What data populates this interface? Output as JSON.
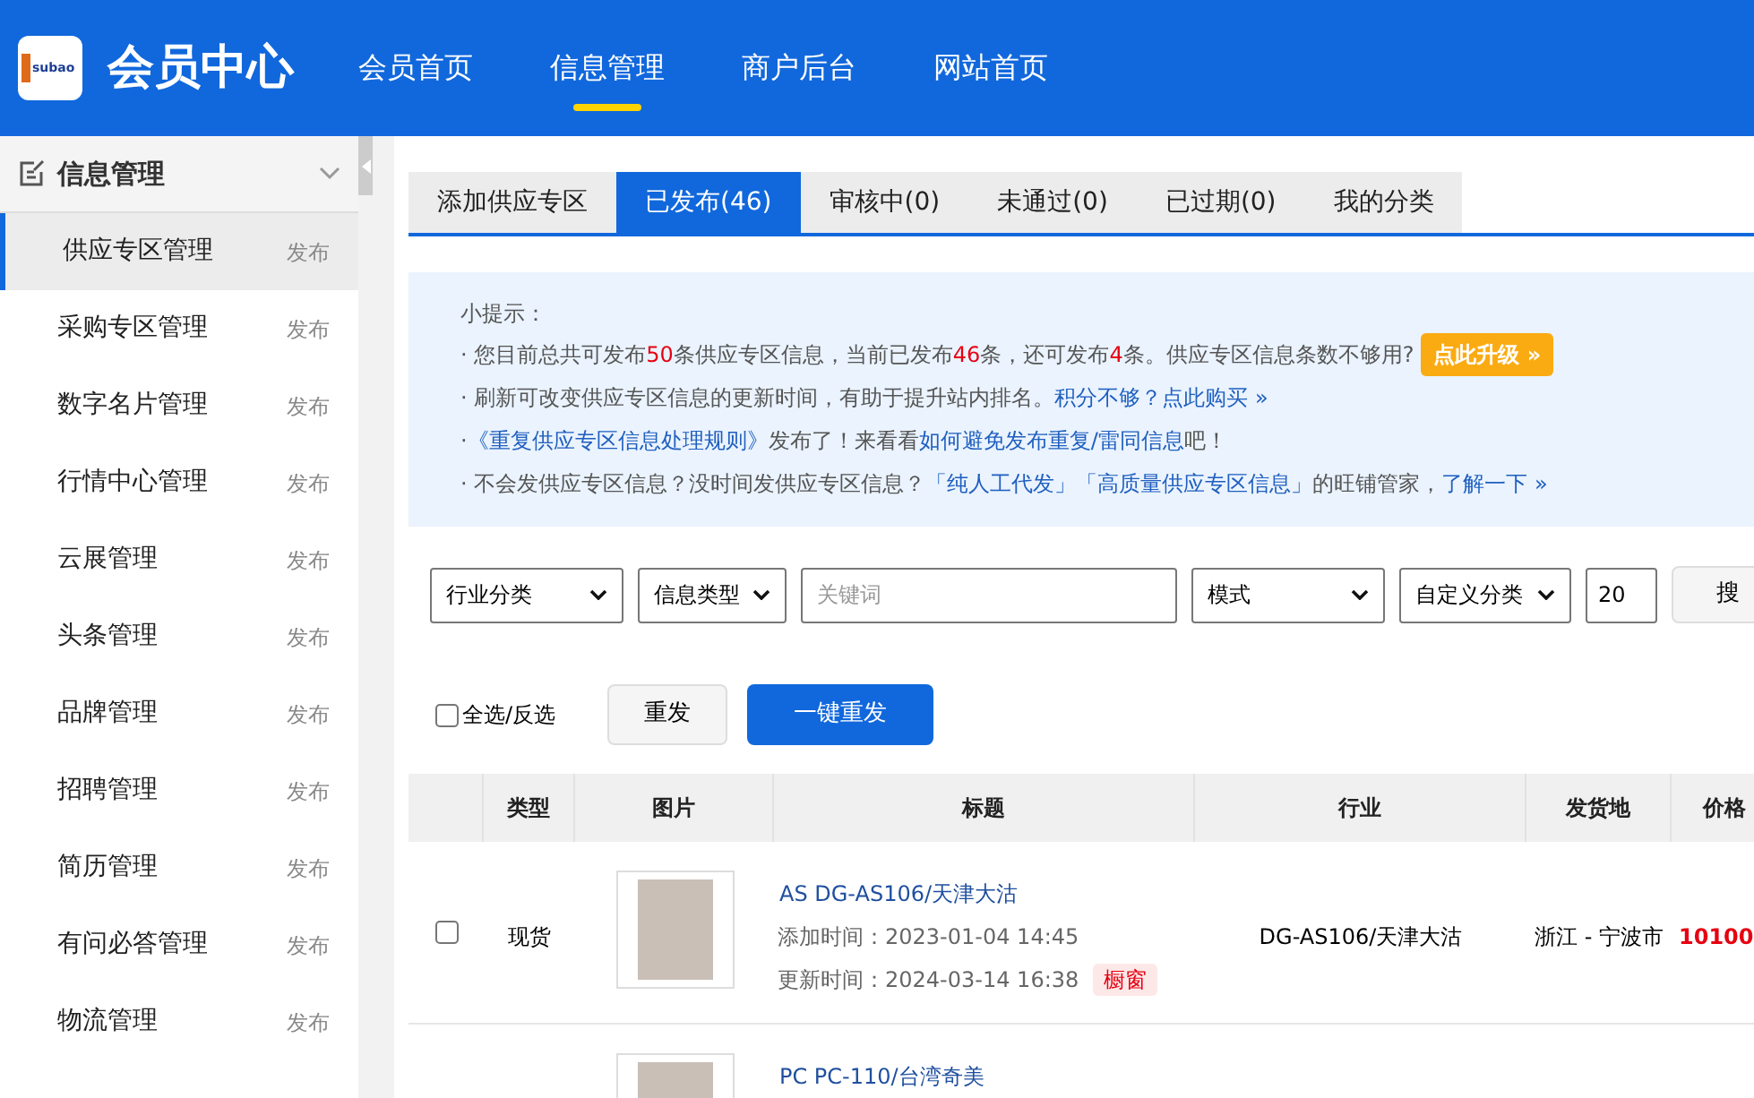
{
  "header": {
    "logo_text": "subao",
    "title": "会员中心",
    "nav": [
      {
        "label": "会员首页",
        "selected": false
      },
      {
        "label": "信息管理",
        "selected": true
      },
      {
        "label": "商户后台",
        "selected": false
      },
      {
        "label": "网站首页",
        "selected": false
      }
    ]
  },
  "sidebar": {
    "title": "信息管理",
    "expanded": true,
    "items": [
      {
        "label": "供应专区管理",
        "action": "发布",
        "selected": true
      },
      {
        "label": "采购专区管理",
        "action": "发布",
        "selected": false
      },
      {
        "label": "数字名片管理",
        "action": "发布",
        "selected": false
      },
      {
        "label": "行情中心管理",
        "action": "发布",
        "selected": false
      },
      {
        "label": "云展管理",
        "action": "发布",
        "selected": false
      },
      {
        "label": "头条管理",
        "action": "发布",
        "selected": false
      },
      {
        "label": "品牌管理",
        "action": "发布",
        "selected": false
      },
      {
        "label": "招聘管理",
        "action": "发布",
        "selected": false
      },
      {
        "label": "简历管理",
        "action": "发布",
        "selected": false
      },
      {
        "label": "有问必答管理",
        "action": "发布",
        "selected": false
      },
      {
        "label": "物流管理",
        "action": "发布",
        "selected": false
      }
    ]
  },
  "tabs": [
    {
      "label": "添加供应专区",
      "selected": false
    },
    {
      "label": "已发布(46)",
      "selected": true
    },
    {
      "label": "审核中(0)",
      "selected": false
    },
    {
      "label": "未通过(0)",
      "selected": false
    },
    {
      "label": "已过期(0)",
      "selected": false
    },
    {
      "label": "我的分类",
      "selected": false
    }
  ],
  "tips": {
    "title": "小提示：",
    "lines": [
      [
        {
          "kind": "text",
          "text": "· 您目前总共可发布"
        },
        {
          "kind": "red",
          "text": "50"
        },
        {
          "kind": "text",
          "text": "条供应专区信息，当前已发布 "
        },
        {
          "kind": "red",
          "text": "46"
        },
        {
          "kind": "text",
          "text": " 条，还可发布"
        },
        {
          "kind": "red",
          "text": "4"
        },
        {
          "kind": "text",
          "text": "条。供应专区信息条数不够用?"
        },
        {
          "kind": "button",
          "text": "点此升级 »"
        }
      ],
      [
        {
          "kind": "text",
          "text": "· 刷新可改变供应专区信息的更新时间，有助于提升站内排名。"
        },
        {
          "kind": "link",
          "text": "积分不够？点此购买 »"
        }
      ],
      [
        {
          "kind": "text",
          "text": "· "
        },
        {
          "kind": "link",
          "text": "《重复供应专区信息处理规则》"
        },
        {
          "kind": "text",
          "text": "发布了！来看看"
        },
        {
          "kind": "link",
          "text": "如何避免发布重复/雷同信息"
        },
        {
          "kind": "text",
          "text": "吧！"
        }
      ],
      [
        {
          "kind": "text",
          "text": "· 不会发供应专区信息？没时间发供应专区信息？ "
        },
        {
          "kind": "link",
          "text": "「纯人工代发」「高质量供应专区信息」"
        },
        {
          "kind": "text",
          "text": "的旺铺管家，"
        },
        {
          "kind": "link",
          "text": "了解一下 »"
        }
      ]
    ]
  },
  "filters": [
    {
      "kind": "select",
      "value": "行业分类"
    },
    {
      "kind": "select",
      "value": "信息类型"
    },
    {
      "kind": "input",
      "placeholder": "关键词"
    },
    {
      "kind": "select",
      "value": "模式"
    },
    {
      "kind": "select",
      "value": "自定义分类"
    },
    {
      "kind": "number",
      "value": "20"
    },
    {
      "kind": "button",
      "value": "搜"
    }
  ],
  "actions": {
    "select_all": {
      "label": "全选/反选",
      "checked": false
    },
    "buttons": [
      {
        "label": "重发",
        "kind": "secondary"
      },
      {
        "label": "一键重发",
        "kind": "primary"
      }
    ]
  },
  "table": {
    "columns": [
      "类型",
      "图片",
      "标题",
      "行业",
      "发货地",
      "价格"
    ],
    "rows": [
      {
        "checked": false,
        "type": "现货",
        "title": "AS DG-AS106/天津大沽",
        "added": "添加时间：2023-01-04 14:45",
        "updated": "更新时间：2024-03-14 16:38",
        "tag": "橱窗",
        "industry": "DG-AS106/天津大沽",
        "location": "浙江 - 宁波市",
        "price": "10100"
      },
      {
        "title": "PC PC-110/台湾奇美"
      }
    ]
  }
}
